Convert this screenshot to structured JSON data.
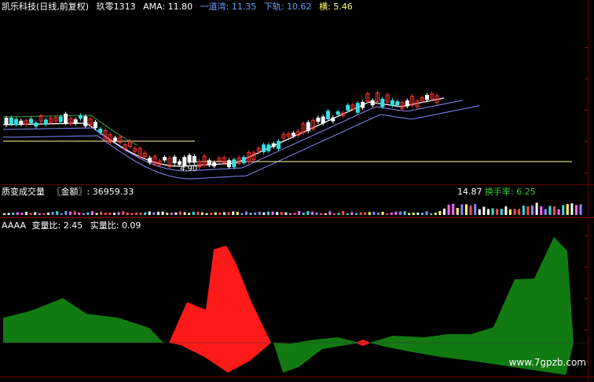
{
  "price_panel": {
    "title": "凯乐科技(日线,前复权)",
    "indicator_name": "玖零1313",
    "lines": [
      {
        "label": "AMA: ",
        "value": "11.80",
        "color": "#ffffff"
      },
      {
        "label": "一道湾: ",
        "value": "11.35",
        "color": "#6aa0ff"
      },
      {
        "label": "下轨: ",
        "value": "10.62",
        "color": "#6aa0ff"
      },
      {
        "label": "横: ",
        "value": "5.46",
        "color": "#ffff66"
      }
    ],
    "low_marker": "4.90",
    "colors": {
      "up": "#ff3030",
      "down": "#33e0e0",
      "ma": "#ffffff",
      "band": "#8888ff",
      "level": "#ffff99"
    }
  },
  "volume_panel": {
    "title": "质变成交量",
    "field_label": "〖金额〗",
    "field_value": "36959.33",
    "right_value": "14.87",
    "turnover_label": "换手率",
    "turnover_value": "6.25",
    "turnover_color": "#33cc33"
  },
  "ratio_panel": {
    "name": "AAAA",
    "change_ratio_label": "变量比",
    "change_ratio_value": "2.45",
    "real_ratio_label": "实量比",
    "real_ratio_value": "0.09",
    "colors": {
      "positive": "#ff1a1a",
      "negative": "#127a12"
    }
  },
  "watermark": "www.7gpzb.com"
}
